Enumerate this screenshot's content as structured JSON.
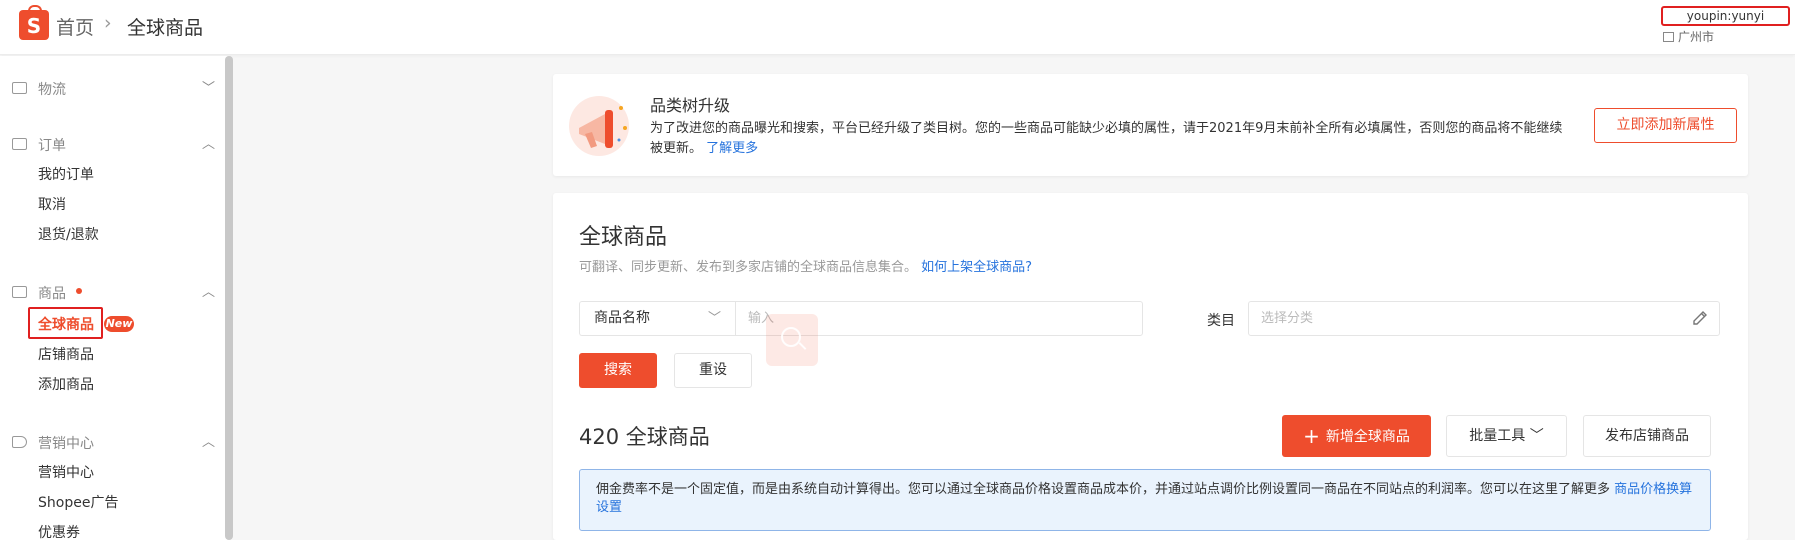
{
  "header": {
    "logo_letter": "S",
    "breadcrumb_home": "首页",
    "breadcrumb_separator": "›",
    "breadcrumb_current": "全球商品",
    "username": "youpin:yunyi",
    "city": "广州市"
  },
  "sidebar": {
    "sections": [
      {
        "label": "物流",
        "chevron": "﹀",
        "icon": "truck-icon"
      },
      {
        "label": "订单",
        "chevron": "︿",
        "icon": "document-icon",
        "items": [
          "我的订单",
          "取消",
          "退货/退款"
        ]
      },
      {
        "label": "商品",
        "chevron": "︿",
        "icon": "box-icon",
        "active_item": "全球商品",
        "badge": "New",
        "items": [
          "店铺商品",
          "添加商品"
        ]
      },
      {
        "label": "营销中心",
        "chevron": "︿",
        "icon": "tag-icon",
        "items": [
          "营销中心",
          "Shopee广告",
          "优惠券"
        ]
      }
    ]
  },
  "notice": {
    "title": "品类树升级",
    "desc": "为了改进您的商品曝光和搜索，平台已经升级了类目树。您的一些商品可能缺少必填的属性，请于2021年9月末前补全所有必填属性，否则您的商品将不能继续被更新。",
    "link": "了解更多",
    "button": "立即添加新属性"
  },
  "main": {
    "title": "全球商品",
    "subtitle": "可翻译、同步更新、发布到多家店铺的全球商品信息集合。",
    "subtitle_link": "如何上架全球商品?",
    "filter_select": "商品名称",
    "filter_placeholder": "输入",
    "category_label": "类目",
    "category_placeholder": "选择分类",
    "search_button": "搜索",
    "reset_button": "重设",
    "count_title": "420 全球商品",
    "add_button": "新增全球商品",
    "batch_button": "批量工具",
    "publish_button": "发布店铺商品",
    "info_text": "佣金费率不是一个固定值，而是由系统自动计算得出。您可以通过全球商品价格设置商品成本价，并通过站点调价比例设置同一商品在不同站点的利润率。您可以在这里了解更多",
    "info_link": "商品价格换算设置"
  },
  "colors": {
    "brand": "#ee4d2d",
    "link": "#2673dd",
    "info_bg": "#eaf3fd",
    "highlight_border": "#e02020"
  }
}
